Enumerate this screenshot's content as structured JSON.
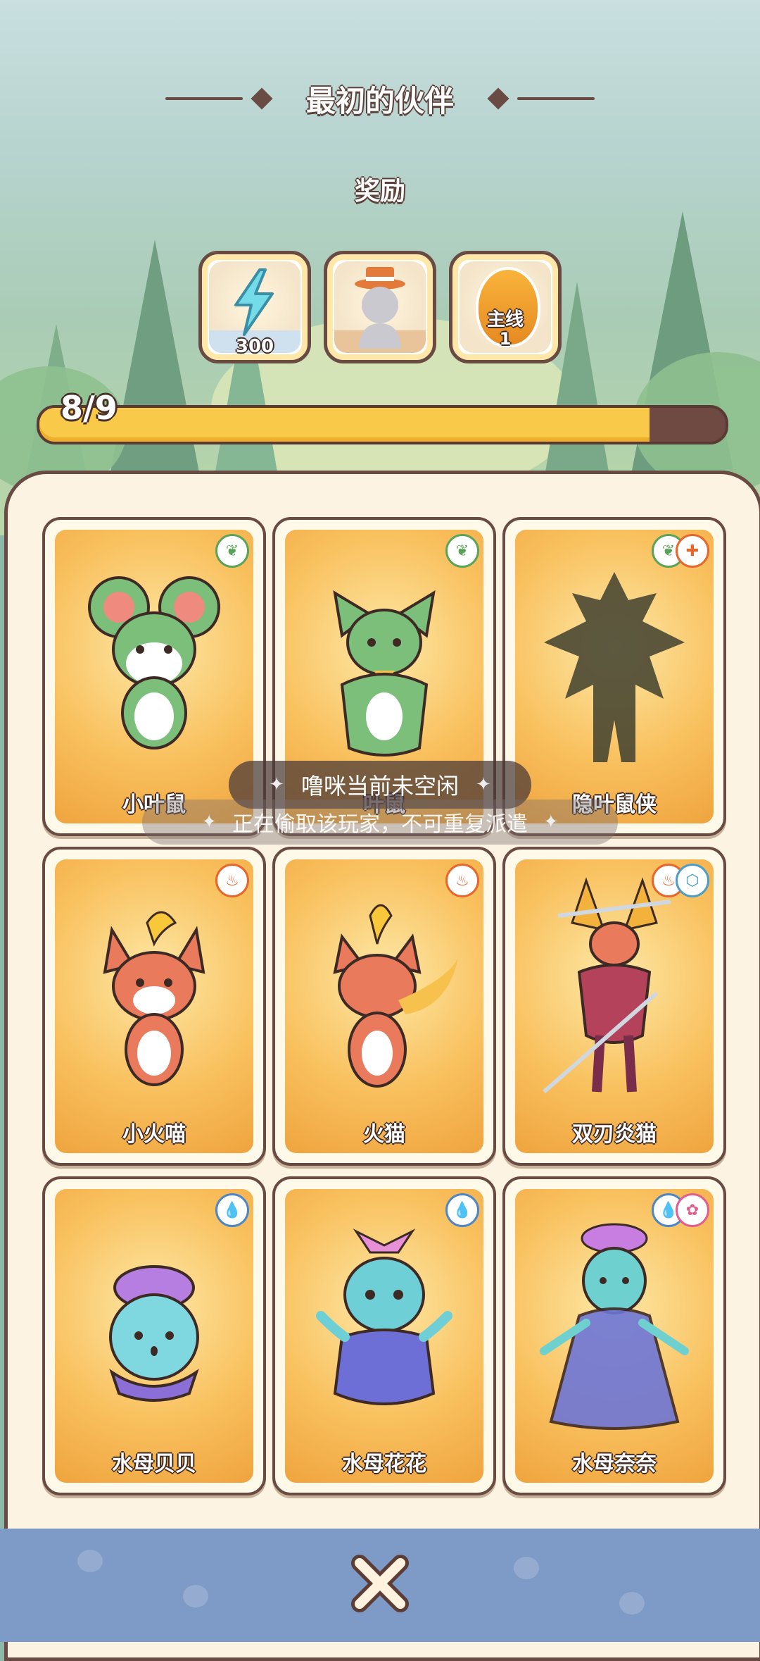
{
  "header": {
    "title": "最初的伙伴",
    "reward_label": "奖励"
  },
  "rewards": [
    {
      "icon": "energy-bolt-icon",
      "quantity": "300"
    },
    {
      "icon": "outfit-hat-icon",
      "quantity": ""
    },
    {
      "icon": "mainline-egg-icon",
      "label": "主线",
      "quantity": "1"
    }
  ],
  "progress": {
    "text": "8/9",
    "value": 8,
    "max": 9
  },
  "cards": [
    {
      "name": "小叶鼠",
      "elements": [
        "grass"
      ],
      "silhouette": false
    },
    {
      "name": "叶鼠",
      "elements": [
        "grass"
      ],
      "silhouette": false
    },
    {
      "name": "隐叶鼠侠",
      "elements": [
        "grass",
        "fight"
      ],
      "silhouette": true
    },
    {
      "name": "小火喵",
      "elements": [
        "fire"
      ],
      "silhouette": false
    },
    {
      "name": "火猫",
      "elements": [
        "fire"
      ],
      "silhouette": false
    },
    {
      "name": "双刃炎猫",
      "elements": [
        "fire",
        "steel"
      ],
      "silhouette": false
    },
    {
      "name": "水母贝贝",
      "elements": [
        "water"
      ],
      "silhouette": false
    },
    {
      "name": "水母花花",
      "elements": [
        "water"
      ],
      "silhouette": false
    },
    {
      "name": "水母奈奈",
      "elements": [
        "water",
        "fairy"
      ],
      "silhouette": false
    }
  ],
  "toasts": {
    "primary": "噜咪当前未空闲",
    "secondary": "正在偷取该玩家，不可重复派遣"
  },
  "footer": {
    "close_icon": "close-x-icon"
  },
  "colors": {
    "outline": "#6a4b43",
    "progress_fill": "#f9c94a",
    "progress_track": "#6e4a42",
    "panel": "#fdf3e3",
    "bottom_bar": "#7e9ac6"
  }
}
